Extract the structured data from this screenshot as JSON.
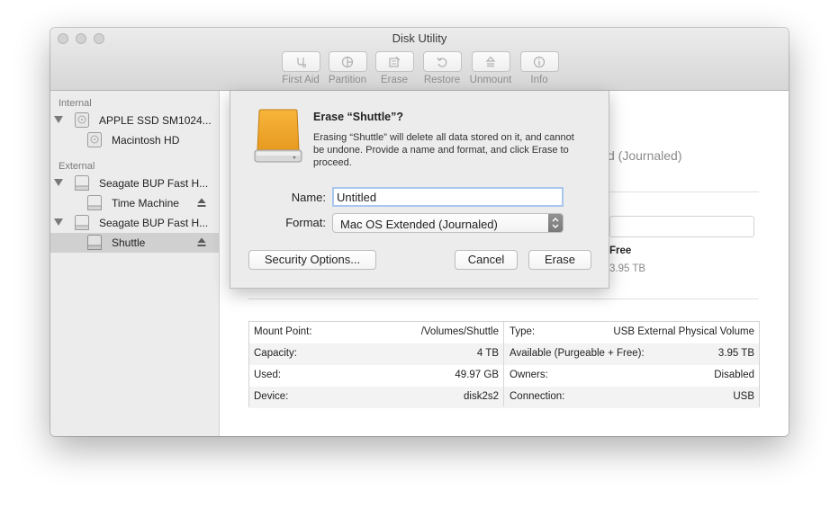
{
  "window": {
    "title": "Disk Utility"
  },
  "toolbar": {
    "items": [
      {
        "label": "First Aid",
        "icon": "stethoscope-icon"
      },
      {
        "label": "Partition",
        "icon": "partition-icon"
      },
      {
        "label": "Erase",
        "icon": "erase-icon"
      },
      {
        "label": "Restore",
        "icon": "restore-icon"
      },
      {
        "label": "Unmount",
        "icon": "unmount-icon"
      },
      {
        "label": "Info",
        "icon": "info-icon"
      }
    ]
  },
  "sidebar": {
    "internal_label": "Internal",
    "external_label": "External",
    "items": [
      {
        "label": "APPLE SSD SM1024..."
      },
      {
        "label": "Macintosh HD"
      },
      {
        "label": "Seagate BUP Fast H..."
      },
      {
        "label": "Time Machine"
      },
      {
        "label": "Seagate BUP Fast H..."
      },
      {
        "label": "Shuttle",
        "selected": true
      }
    ]
  },
  "main": {
    "format_partial": "d (Journaled)",
    "free_label": "Free",
    "free_partial": "3.95 TB"
  },
  "info": {
    "rows": [
      {
        "l_label": "Mount Point:",
        "l_value": "/Volumes/Shuttle",
        "r_label": "Type:",
        "r_value": "USB External Physical Volume"
      },
      {
        "l_label": "Capacity:",
        "l_value": "4 TB",
        "r_label": "Available (Purgeable + Free):",
        "r_value": "3.95 TB"
      },
      {
        "l_label": "Used:",
        "l_value": "49.97 GB",
        "r_label": "Owners:",
        "r_value": "Disabled"
      },
      {
        "l_label": "Device:",
        "l_value": "disk2s2",
        "r_label": "Connection:",
        "r_value": "USB"
      }
    ]
  },
  "dialog": {
    "title": "Erase “Shuttle”?",
    "message": "Erasing “Shuttle” will delete all data stored on it, and cannot be undone. Provide a name and format, and click Erase to proceed.",
    "name_label": "Name:",
    "name_value": "Untitled",
    "format_label": "Format:",
    "format_value": "Mac OS Extended (Journaled)",
    "security_button": "Security Options...",
    "cancel_button": "Cancel",
    "erase_button": "Erase"
  },
  "colors": {
    "sidebar_bg": "#ececec",
    "selection": "#d0d0d0",
    "drive_icon": "#f0a62b",
    "focus_ring": "#a9c6ef"
  }
}
